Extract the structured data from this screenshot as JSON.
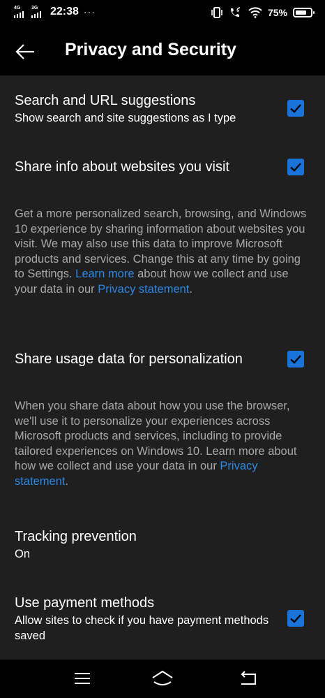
{
  "status_bar": {
    "network_left": "4G",
    "network_right": "3G",
    "time": "22:38",
    "overflow_dots": "···",
    "battery_percent": "75%",
    "battery_level": 0.75,
    "icons": [
      "vibrate-icon",
      "wifi-calling-icon",
      "wifi-icon",
      "battery-icon"
    ]
  },
  "header": {
    "title": "Privacy and Security",
    "back_icon": "back-arrow-icon"
  },
  "settings": [
    {
      "title": "Search and URL suggestions",
      "subtitle": "Show search and site suggestions as I type",
      "checked": true
    },
    {
      "title": "Share info about websites you visit",
      "checked": true,
      "description": {
        "text": "Get a more personalized search, browsing, and Windows 10 experience by sharing information about websites you visit. We may also use this data to improve Microsoft products and services. Change this at any time by going to Settings. ",
        "link1": "Learn more",
        "middle": " about how we collect and use your data in our ",
        "link2": "Privacy statement",
        "end": "."
      }
    },
    {
      "title": "Share usage data for personalization",
      "checked": true,
      "description": {
        "text": "When you share data about how you use the browser, we'll use it to personalize your experiences across Microsoft products and services, including to provide tailored experiences on Windows 10. Learn more about how we collect and use your data in our ",
        "link": "Privacy statement",
        "end": "."
      }
    },
    {
      "title": "Tracking prevention",
      "value": "On"
    },
    {
      "title": "Use payment methods",
      "subtitle": "Allow sites to check if you have payment methods saved",
      "checked": true
    }
  ],
  "colors": {
    "background": "#1f1f1f",
    "bars": "#000000",
    "checkbox": "#1a73d9",
    "link": "#2b88e6",
    "secondary_text": "#a8a8a8"
  },
  "nav_bar": {
    "icons": [
      "menu-icon",
      "home-icon",
      "back-icon"
    ]
  }
}
